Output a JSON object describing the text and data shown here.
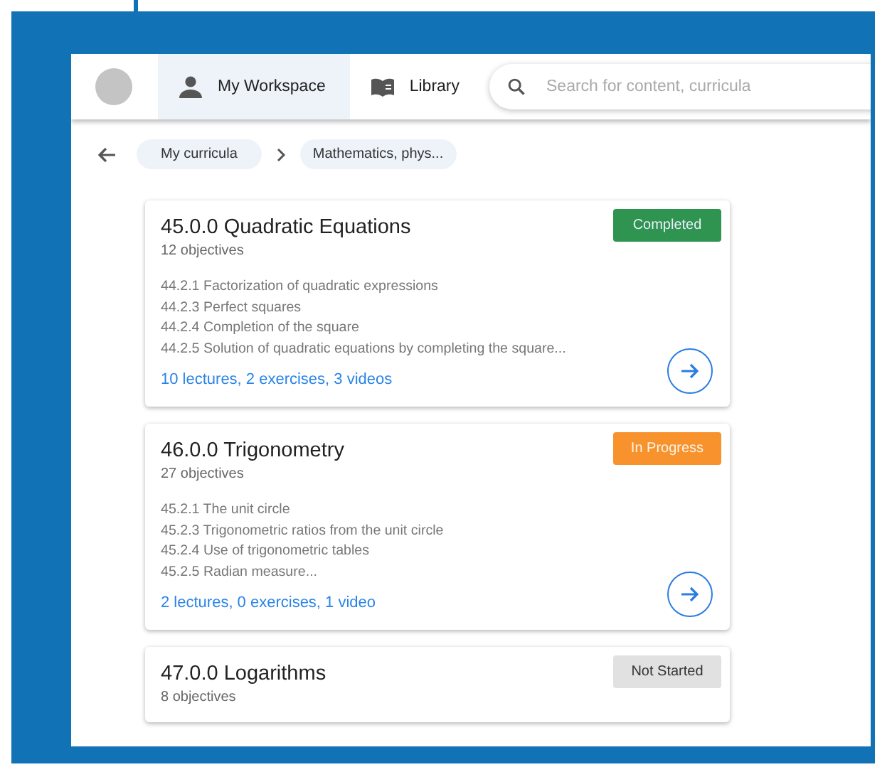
{
  "tabs": [
    {
      "label": "My Workspace",
      "selected": true
    },
    {
      "label": "Library",
      "selected": false
    }
  ],
  "search": {
    "placeholder": "Search for content, curricula"
  },
  "breadcrumbs": [
    "My curricula",
    "Mathematics, phys..."
  ],
  "cards": [
    {
      "title": "45.0.0 Quadratic Equations",
      "subtitle": "12 objectives",
      "status": {
        "label": "Completed",
        "kind": "completed"
      },
      "objectives": [
        "44.2.1 Factorization of quadratic expressions",
        "44.2.3 Perfect squares",
        "44.2.4 Completion of the square",
        "44.2.5 Solution of quadratic equations by completing the square..."
      ],
      "summary": "10 lectures, 2 exercises, 3 videos"
    },
    {
      "title": "46.0.0 Trigonometry",
      "subtitle": "27 objectives",
      "status": {
        "label": "In Progress",
        "kind": "in_progress"
      },
      "objectives": [
        "45.2.1 The unit circle",
        "45.2.3 Trigonometric ratios from the unit circle",
        "45.2.4 Use of trigonometric tables",
        "45.2.5 Radian measure..."
      ],
      "summary": "2 lectures, 0 exercises, 1 video"
    },
    {
      "title": "47.0.0 Logarithms",
      "subtitle": "8 objectives",
      "status": {
        "label": "Not Started",
        "kind": "not_started"
      }
    }
  ]
}
